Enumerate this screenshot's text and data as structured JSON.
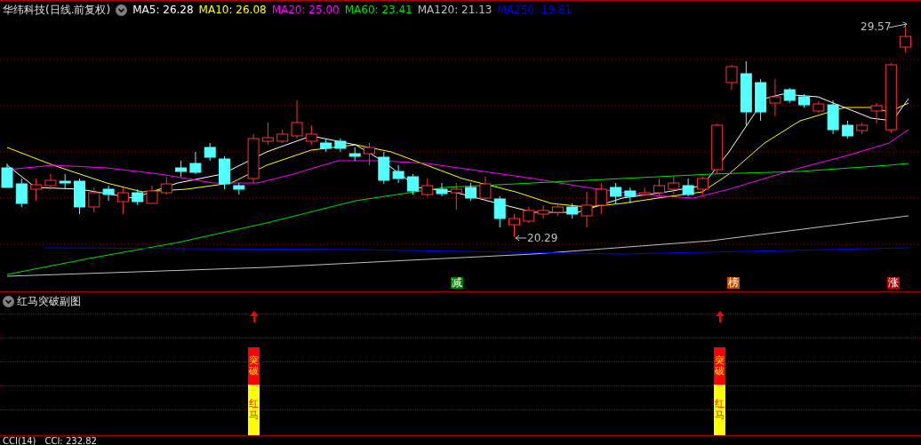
{
  "chart_title": "华纬科技(日线.前复权)",
  "indicators": [
    {
      "label": "MA5: 26.28",
      "color": "#ffffff"
    },
    {
      "label": "MA10: 26.08",
      "color": "#ffff00"
    },
    {
      "label": "MA20: 25.00",
      "color": "#ff00ff"
    },
    {
      "label": "MA60: 23.41",
      "color": "#00e000"
    },
    {
      "label": "MA120: 21.13",
      "color": "#c0c0c0"
    },
    {
      "label": "MA250: 19.81",
      "color": "#0000ff"
    }
  ],
  "price_annotations": [
    {
      "text": "29.57",
      "kind": "high"
    },
    {
      "text": "20.29",
      "kind": "low"
    }
  ],
  "event_markers": [
    {
      "text": "减",
      "color": "#008000"
    },
    {
      "text": "榜",
      "color": "#c05000"
    },
    {
      "text": "涨",
      "color": "#c00000"
    }
  ],
  "subchart": {
    "title": "红马突破副图",
    "signals": [
      {
        "upper": "突破",
        "lower": "红马"
      },
      {
        "upper": "突破",
        "lower": "红马"
      }
    ]
  },
  "bottom_panel": {
    "title": "CCI(14)",
    "reading": "CCI: 232.82"
  }
}
